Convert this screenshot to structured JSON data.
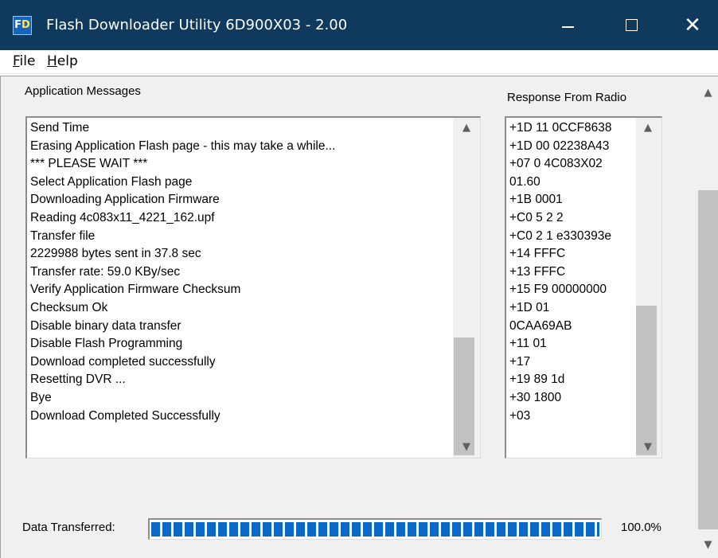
{
  "window": {
    "title": "Flash Downloader Utility 6D900X03 - 2.00",
    "logo_text_f": "F",
    "logo_text_d": "D",
    "title_bg": "#0f3a5e"
  },
  "menu": {
    "file_mnemonic": "F",
    "file_rest": "ile",
    "help_mnemonic": "H",
    "help_rest": "elp"
  },
  "application_messages": {
    "label": "Application Messages",
    "items": [
      "Send Time",
      "Erasing Application Flash page - this may take a while...",
      "*** PLEASE WAIT ***",
      "Select Application Flash page",
      "Downloading Application Firmware",
      "Reading  4c083x11_4221_162.upf",
      "Transfer file",
      "2229988 bytes sent in 37.8 sec",
      "Transfer rate: 59.0 KBy/sec",
      "Verify Application Firmware Checksum",
      "Checksum Ok",
      "Disable binary data transfer",
      "Disable Flash Programming",
      "Download completed successfully",
      "Resetting DVR ...",
      "Bye",
      "Download Completed Successfully"
    ]
  },
  "radio_response": {
    "label": "Response From Radio",
    "items": [
      "+1D 11 0CCF8638",
      "+1D 00 02238A43",
      "+07 0 4C083X02",
      "01.60",
      "+1B 0001",
      "+C0 5 2 2",
      "+C0 2 1 e330393e",
      "+14 FFFC",
      "+13 FFFC",
      "+15 F9 00000000",
      "+1D 01",
      "0CAA69AB",
      "+11 01",
      "+17",
      "+19 89 1d",
      "+30  1800",
      "+03"
    ]
  },
  "progress": {
    "label": "Data Transferred:",
    "percent_text": "100.0%",
    "fraction": 1.0,
    "fill_color": "#0a69c7"
  },
  "icons": {
    "scroll_up": "▲",
    "scroll_down": "▼",
    "close": "✕"
  }
}
